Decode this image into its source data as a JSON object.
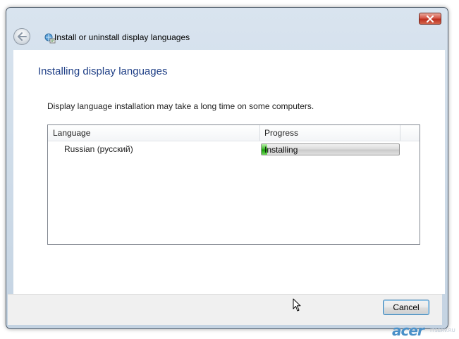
{
  "window": {
    "nav_title": "Install or uninstall display languages",
    "close_label": "×"
  },
  "page": {
    "title": "Installing display languages",
    "description": "Display language installation may take a long time on some computers."
  },
  "list": {
    "columns": [
      "Language",
      "Progress"
    ],
    "rows": [
      {
        "language": "Russian (русский)",
        "progress_label": "Installing",
        "progress_percent": 4
      }
    ]
  },
  "footer": {
    "cancel_label": "Cancel"
  },
  "watermark": {
    "logo": "acer",
    "site": "ITSERV.RU"
  },
  "colors": {
    "title_blue": "#1f3f86",
    "progress_green": "#17a007",
    "close_red": "#bd2f1f"
  },
  "icons": {
    "back": "back-arrow-icon",
    "app": "language-globe-icon",
    "close": "close-icon"
  }
}
